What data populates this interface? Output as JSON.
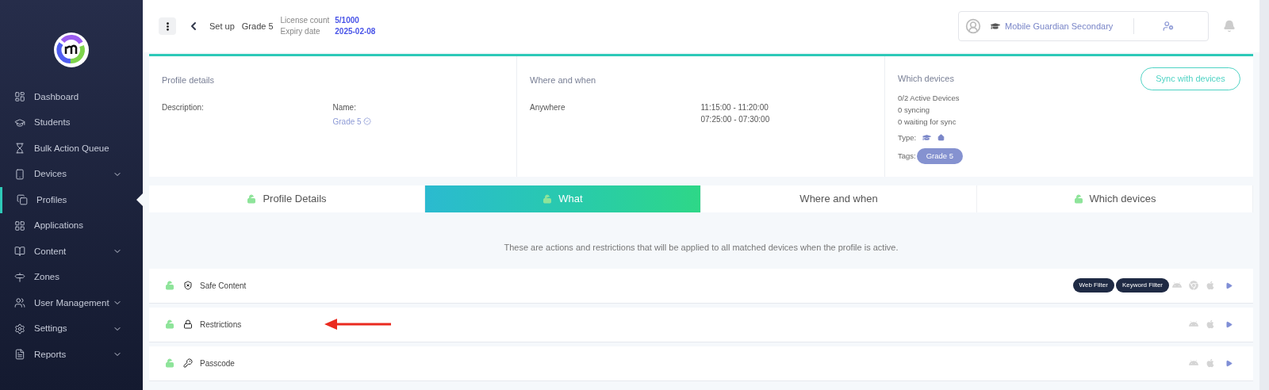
{
  "sidebar": {
    "items": [
      {
        "label": "Dashboard",
        "selected": false,
        "expandable": false
      },
      {
        "label": "Students",
        "selected": false,
        "expandable": false
      },
      {
        "label": "Bulk Action Queue",
        "selected": false,
        "expandable": false
      },
      {
        "label": "Devices",
        "selected": false,
        "expandable": true
      },
      {
        "label": "Profiles",
        "selected": true,
        "expandable": false
      },
      {
        "label": "Applications",
        "selected": false,
        "expandable": false
      },
      {
        "label": "Content",
        "selected": false,
        "expandable": true
      },
      {
        "label": "Zones",
        "selected": false,
        "expandable": false
      },
      {
        "label": "User Management",
        "selected": false,
        "expandable": true
      },
      {
        "label": "Settings",
        "selected": false,
        "expandable": true
      },
      {
        "label": "Reports",
        "selected": false,
        "expandable": true
      }
    ]
  },
  "header": {
    "breadcrumb": [
      "Set up",
      "Grade 5"
    ],
    "license_label": "License count",
    "license_value": "5/1000",
    "expiry_label": "Expiry date",
    "expiry_value": "2025-02-08",
    "school": "Mobile Guardian Secondary"
  },
  "profile_details": {
    "title": "Profile details",
    "description_label": "Description:",
    "name_label": "Name:",
    "name_value": "Grade 5"
  },
  "where_and_when": {
    "title": "Where and when",
    "location": "Anywhere",
    "times": [
      "11:15:00 - 11:20:00",
      "07:25:00 - 07:30:00"
    ]
  },
  "which_devices": {
    "title": "Which devices",
    "sync_button": "Sync with devices",
    "stats": [
      "0/2 Active Devices",
      "0 syncing",
      "0 waiting for sync"
    ],
    "type_label": "Type:",
    "tags_label": "Tags:",
    "tags": [
      "Grade 5"
    ]
  },
  "tabs": [
    {
      "label": "Profile Details",
      "selected": false,
      "lock_icon": true
    },
    {
      "label": "What",
      "selected": true,
      "lock_icon": true
    },
    {
      "label": "Where and when",
      "selected": false,
      "lock_icon": false
    },
    {
      "label": "Which devices",
      "selected": false,
      "lock_icon": true
    }
  ],
  "intro": "These are actions and restrictions that will be applied to all matched devices when the profile is active.",
  "sections": [
    {
      "label": "Safe Content",
      "filters": [
        "Web Filter",
        "Keyword Filter"
      ],
      "platforms": [
        {
          "kind": "android"
        },
        {
          "kind": "chrome"
        },
        {
          "kind": "apple"
        }
      ]
    },
    {
      "label": "Restrictions",
      "platforms": [
        {
          "kind": "android"
        },
        {
          "kind": "apple"
        }
      ],
      "annotated": true
    },
    {
      "label": "Passcode",
      "platforms": [
        {
          "kind": "android"
        },
        {
          "kind": "apple"
        }
      ]
    }
  ]
}
